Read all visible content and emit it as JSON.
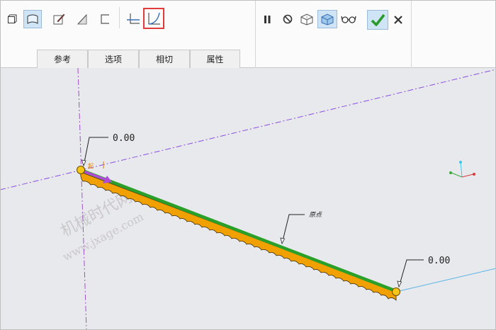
{
  "tabs": [
    {
      "label": "参考"
    },
    {
      "label": "选项"
    },
    {
      "label": "相切"
    },
    {
      "label": "属性"
    }
  ],
  "toolbar": {
    "left_icons": [
      "solid-icon",
      "surface-icon",
      "sketch-icon",
      "plane-icon",
      "bracket-icon",
      "constant-section-icon",
      "variable-section-trajectory-icon"
    ],
    "right_icons": [
      "pause-icon",
      "no-preview-icon",
      "geometry-preview-icon",
      "verify-icon",
      "glasses-icon",
      "ok-icon",
      "cancel-icon"
    ],
    "highlighted_icon": "variable-section-trajectory-icon"
  },
  "viewport": {
    "dimension_start": "0.00",
    "dimension_end": "0.00",
    "origin_label": "原点",
    "start_marker": "起",
    "watermark_cn": "机械时代网",
    "watermark_url": "www.jxage.com"
  },
  "colors": {
    "trajectory": "#2aa02a",
    "sweep_surface": "#f0a000",
    "direction_arrow": "#b04ad8",
    "datum_line": "#8a4fe0",
    "highlight_box": "#e03c3c"
  }
}
